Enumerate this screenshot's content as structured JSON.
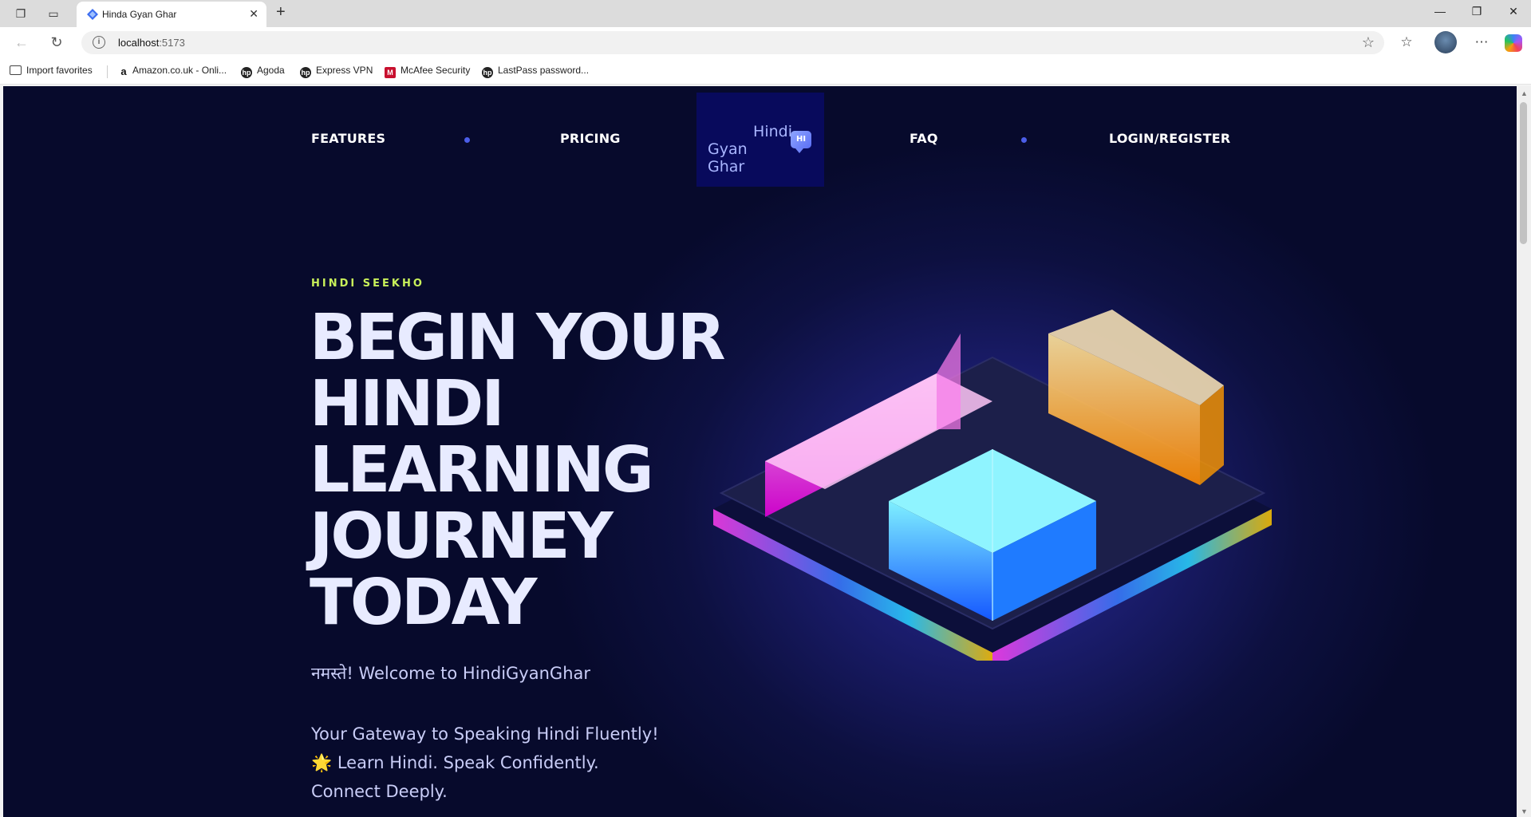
{
  "browser": {
    "tab_title": "Hinda Gyan Ghar",
    "url_host": "localhost",
    "url_port": ":5173",
    "bookmarks": [
      {
        "label": "Import favorites",
        "icon": "folder-icon"
      },
      {
        "label": "Amazon.co.uk - Onli...",
        "icon": "amazon-icon"
      },
      {
        "label": "Agoda",
        "icon": "hp-icon"
      },
      {
        "label": "Express VPN",
        "icon": "hp-icon"
      },
      {
        "label": "McAfee Security",
        "icon": "mcafee-icon"
      },
      {
        "label": "LastPass password...",
        "icon": "hp-icon"
      }
    ]
  },
  "site": {
    "nav": {
      "features": "FEATURES",
      "pricing": "PRICING",
      "faq": "FAQ",
      "login": "LOGIN/REGISTER"
    },
    "logo": {
      "line1": "Hindi",
      "line2": "Gyan Ghar",
      "badge": "HI"
    },
    "hero": {
      "kicker": "HINDI SEEKHO",
      "headline": [
        "BEGIN YOUR",
        "HINDI",
        "LEARNING",
        "JOURNEY",
        "TODAY"
      ],
      "welcome": "नमस्ते! Welcome to HindiGyanGhar",
      "tagline": [
        "Your Gateway to Speaking Hindi Fluently!",
        "🌟 Learn Hindi. Speak Confidently.",
        "Connect Deeply."
      ]
    }
  },
  "colors": {
    "background": "#070a2c",
    "accent_kicker": "#c8f05a",
    "nav_dot": "#4b5ee8",
    "logo_bg": "#080a5c"
  }
}
